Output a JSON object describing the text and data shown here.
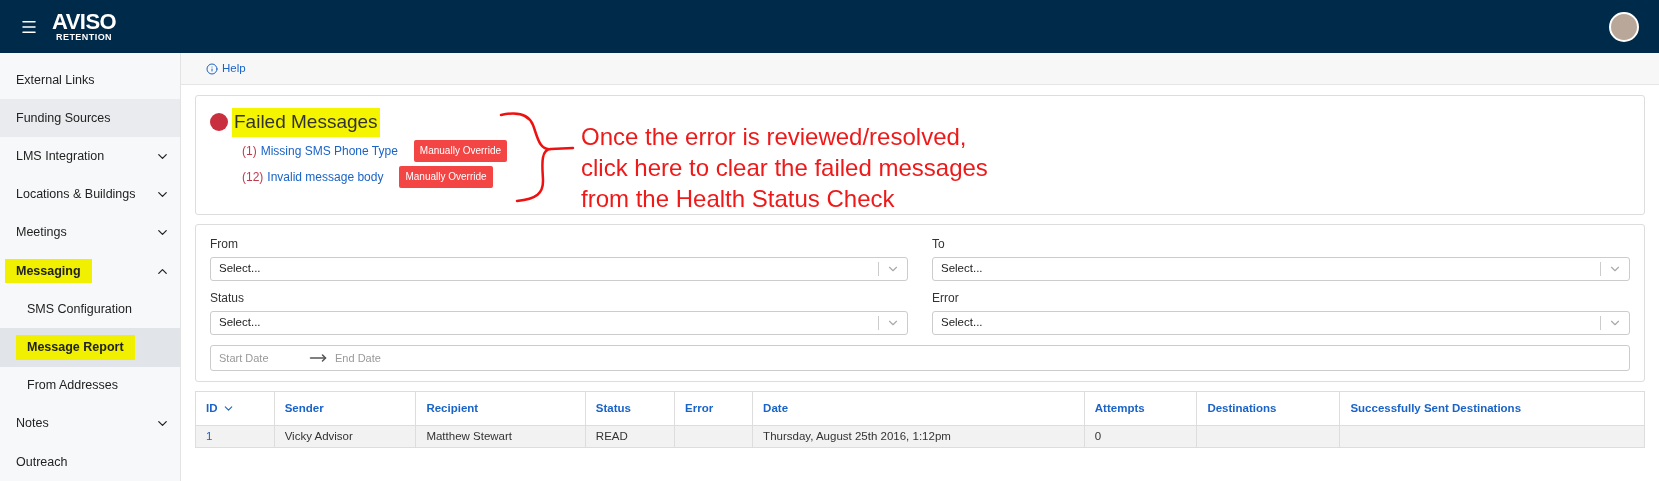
{
  "header": {
    "logo_main": "AVISO",
    "logo_sub": "RETENTION"
  },
  "sidebar": {
    "items": [
      {
        "label": "External Links",
        "hovered": false,
        "selected": false,
        "highlighted": false
      },
      {
        "label": "Funding Sources",
        "hovered": true,
        "selected": false,
        "highlighted": false
      },
      {
        "label": "LMS Integration",
        "hovered": false,
        "selected": false,
        "highlighted": false,
        "expanded": false
      },
      {
        "label": "Locations & Buildings",
        "hovered": false,
        "selected": false,
        "highlighted": false,
        "expanded": false
      },
      {
        "label": "Meetings",
        "hovered": false,
        "selected": false,
        "highlighted": false,
        "expanded": false
      },
      {
        "label": "Messaging",
        "hovered": false,
        "selected": false,
        "highlighted": true,
        "expanded": true,
        "children": [
          {
            "label": "SMS Configuration",
            "selected": false,
            "highlighted": false
          },
          {
            "label": "Message Report",
            "selected": true,
            "highlighted": true
          },
          {
            "label": "From Addresses",
            "selected": false,
            "highlighted": false
          }
        ]
      },
      {
        "label": "Notes",
        "hovered": false,
        "selected": false,
        "highlighted": false,
        "expanded": false
      },
      {
        "label": "Outreach",
        "hovered": false,
        "selected": false,
        "highlighted": false
      }
    ]
  },
  "help_link": "Help",
  "failed_card": {
    "title": "Failed Messages",
    "highlighted": true,
    "failed": true,
    "errors": [
      {
        "count": "(1)",
        "label": "Missing SMS Phone Type",
        "button": "Manually Override"
      },
      {
        "count": "(12)",
        "label": "Invalid message body",
        "button": "Manually Override"
      }
    ]
  },
  "annotation": {
    "lines": [
      "Once the error is reviewed/resolved,",
      "click here to clear the failed messages",
      "from the Health Status Check"
    ]
  },
  "filters": [
    {
      "label": "From",
      "placeholder": "Select..."
    },
    {
      "label": "To",
      "placeholder": "Select..."
    },
    {
      "label": "Status",
      "placeholder": "Select..."
    },
    {
      "label": "Error",
      "placeholder": "Select..."
    }
  ],
  "date_range": {
    "start_placeholder": "Start Date",
    "end_placeholder": "End Date"
  },
  "table": {
    "columns": [
      {
        "label": "ID",
        "sorted": true
      },
      {
        "label": "Sender",
        "sorted": false
      },
      {
        "label": "Recipient",
        "sorted": false
      },
      {
        "label": "Status",
        "sorted": false
      },
      {
        "label": "Error",
        "sorted": false
      },
      {
        "label": "Date",
        "sorted": false
      },
      {
        "label": "Attempts",
        "sorted": false
      },
      {
        "label": "Destinations",
        "sorted": false
      },
      {
        "label": "Successfully Sent Destinations",
        "sorted": false
      }
    ],
    "rows": [
      [
        "1",
        "Vicky Advisor",
        "Matthew Stewart",
        "READ",
        "",
        "Thursday, August 25th 2016, 1:12pm",
        "0",
        "",
        ""
      ]
    ]
  }
}
